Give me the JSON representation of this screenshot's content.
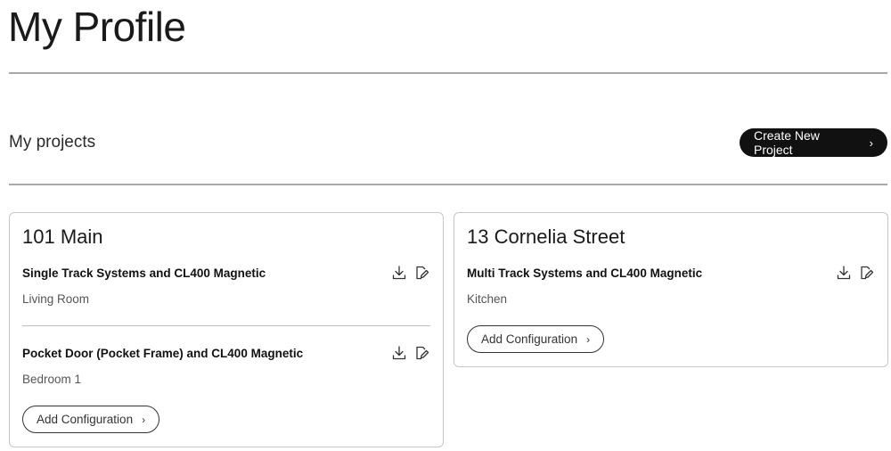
{
  "page": {
    "title": "My Profile"
  },
  "projects_section": {
    "title": "My projects",
    "create_button": "Create New Project",
    "chevron": "›"
  },
  "projects": [
    {
      "name": "101 Main",
      "configurations": [
        {
          "name": "Single Track Systems and CL400 Magnetic",
          "room": "Living Room"
        },
        {
          "name": "Pocket Door (Pocket Frame) and CL400 Magnetic",
          "room": "Bedroom 1"
        }
      ],
      "add_button": "Add Configuration"
    },
    {
      "name": "13 Cornelia Street",
      "configurations": [
        {
          "name": "Multi Track Systems and CL400 Magnetic",
          "room": "Kitchen"
        }
      ],
      "add_button": "Add Configuration"
    }
  ],
  "icons": {
    "download": "download-icon",
    "edit": "edit-icon"
  },
  "colors": {
    "primary_button_bg": "#111111",
    "primary_button_text": "#ffffff",
    "rule": "#a8a8a8",
    "card_border": "#c7c7c7"
  }
}
